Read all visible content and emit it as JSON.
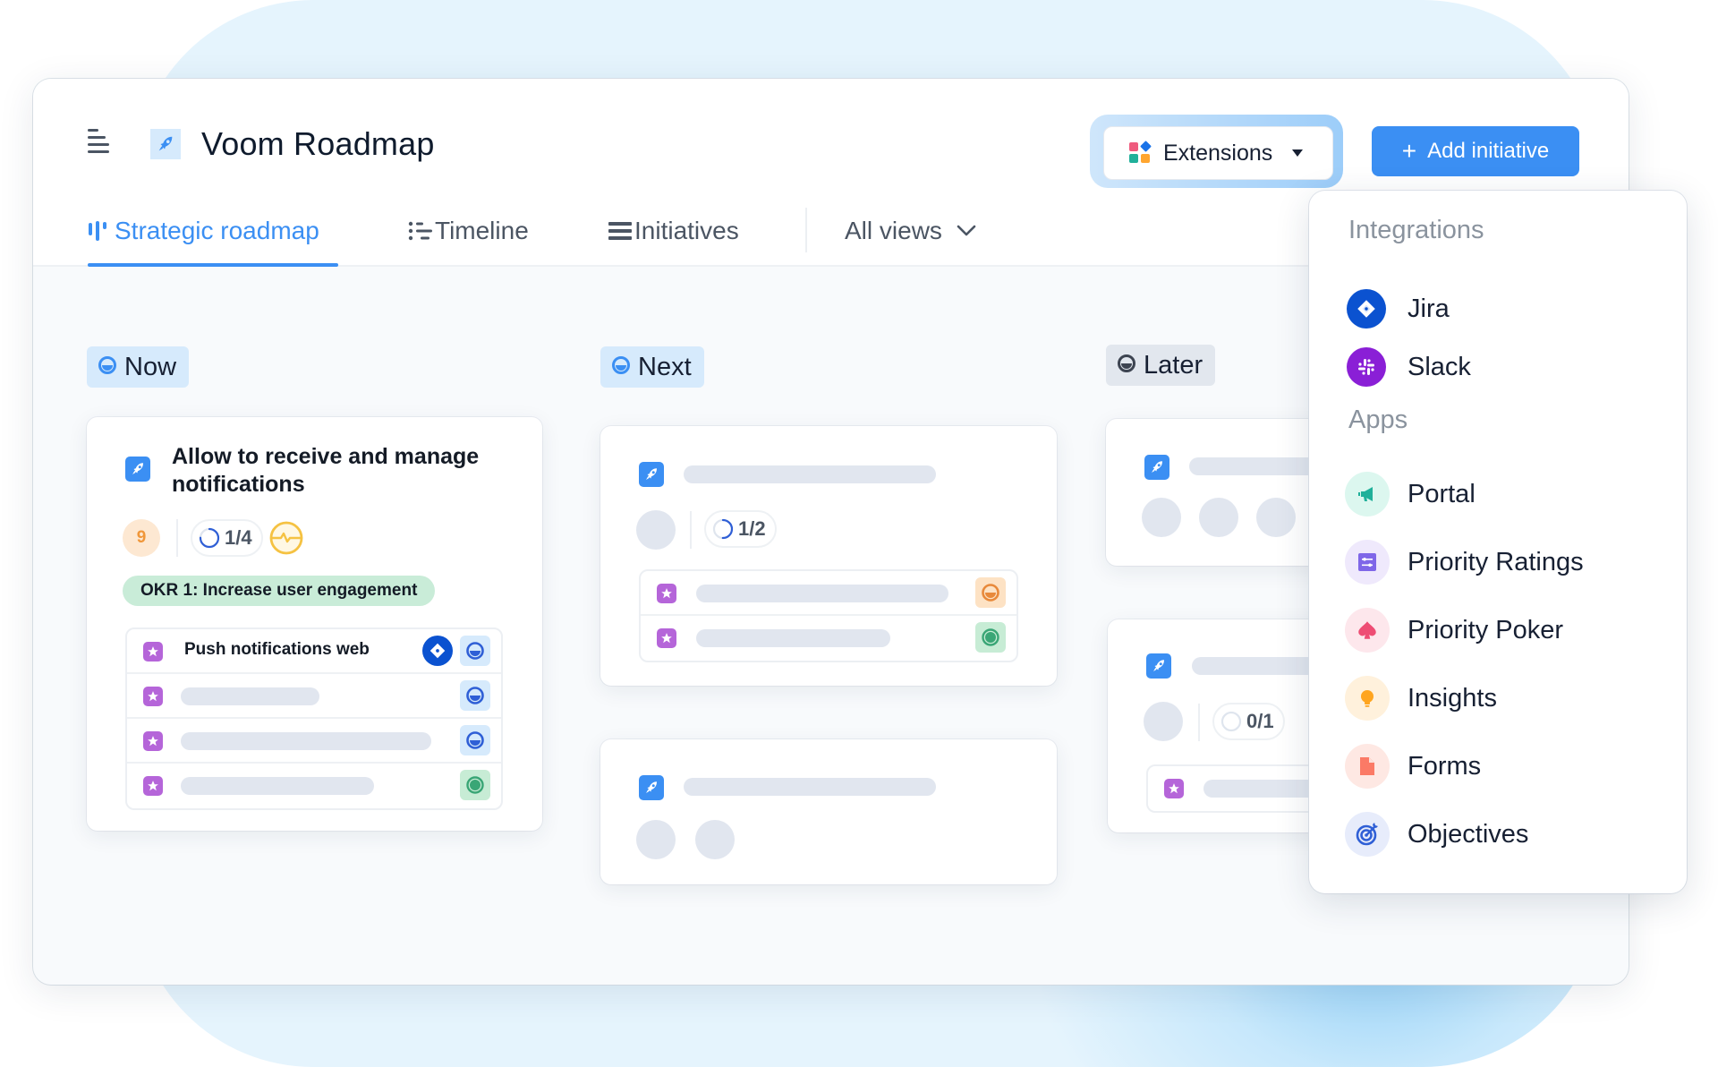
{
  "app": {
    "title": "Voom Roadmap",
    "has_notification": true
  },
  "toolbar": {
    "extensions_label": "Extensions",
    "add_initiative_label": "Add initiative"
  },
  "tabs": [
    {
      "label": "Strategic roadmap",
      "icon": "roadmap-icon",
      "active": true
    },
    {
      "label": "Timeline",
      "icon": "timeline-icon",
      "active": false
    },
    {
      "label": "Initiatives",
      "icon": "list-icon",
      "active": false
    }
  ],
  "views_dropdown": {
    "label": "All views"
  },
  "columns": [
    {
      "label": "Now",
      "cards": [
        {
          "title": "Allow to receive and manage notifications",
          "score": "9",
          "progress": "1/4",
          "progress_fraction": 0.75,
          "health": "warning",
          "okr": "OKR 1: Increase user engagement",
          "subitems": [
            {
              "title": "Push notifications web",
              "has_jira": true,
              "status": "in-progress"
            },
            {
              "title": "",
              "status": "in-progress"
            },
            {
              "title": "",
              "status": "in-progress"
            },
            {
              "title": "",
              "status": "done"
            }
          ]
        }
      ]
    },
    {
      "label": "Next",
      "cards": [
        {
          "title": "",
          "progress": "1/2",
          "progress_fraction": 0.5,
          "subitems": [
            {
              "status": "paused"
            },
            {
              "status": "done"
            }
          ]
        },
        {
          "title": ""
        }
      ]
    },
    {
      "label": "Later",
      "cards": [
        {
          "title": ""
        },
        {
          "title": "",
          "progress": "0/1",
          "progress_fraction": 0
        }
      ]
    }
  ],
  "extensions_menu": {
    "integrations_heading": "Integrations",
    "integrations": [
      {
        "label": "Jira",
        "icon": "jira-icon",
        "color": "#0b52d0"
      },
      {
        "label": "Slack",
        "icon": "slack-icon",
        "color": "#8a1fd6"
      }
    ],
    "apps_heading": "Apps",
    "apps": [
      {
        "label": "Portal",
        "icon": "megaphone-icon",
        "color": "#20b09a",
        "bg": "#dcf7ef"
      },
      {
        "label": "Priority Ratings",
        "icon": "sliders-icon",
        "color": "#7f67e8",
        "bg": "#efe9fc"
      },
      {
        "label": "Priority Poker",
        "icon": "spade-icon",
        "color": "#ee4d74",
        "bg": "#fde7ec"
      },
      {
        "label": "Insights",
        "icon": "lightbulb-icon",
        "color": "#ffa51f",
        "bg": "#fff1dc"
      },
      {
        "label": "Forms",
        "icon": "document-icon",
        "color": "#fb7a66",
        "bg": "#fee8e3"
      },
      {
        "label": "Objectives",
        "icon": "target-icon",
        "color": "#2f5fd6",
        "bg": "#e7ecfb"
      }
    ]
  },
  "colors": {
    "accent": "#3b8ff3",
    "status_in_progress": "#2f5fd6",
    "status_done": "#3aa676",
    "status_paused": "#e8893a"
  }
}
